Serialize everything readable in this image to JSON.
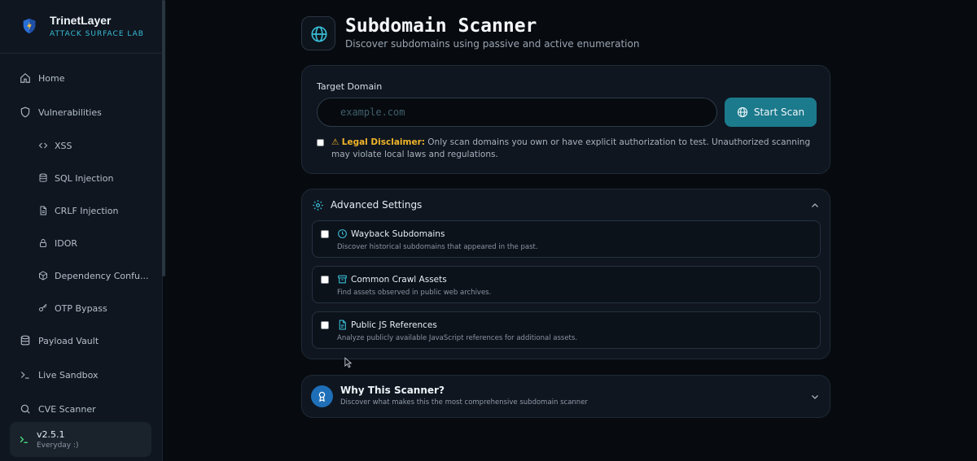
{
  "brand": {
    "name": "TrinetLayer",
    "tagline": "ATTACK SURFACE LAB"
  },
  "sidebar": {
    "items": [
      {
        "label": "Home",
        "icon": "home-icon"
      },
      {
        "label": "Vulnerabilities",
        "icon": "shield-icon"
      },
      {
        "label": "XSS",
        "icon": "code-icon"
      },
      {
        "label": "SQL Injection",
        "icon": "database-icon"
      },
      {
        "label": "CRLF Injection",
        "icon": "file-icon"
      },
      {
        "label": "IDOR",
        "icon": "lock-icon"
      },
      {
        "label": "Dependency Confu...",
        "icon": "package-icon"
      },
      {
        "label": "OTP Bypass",
        "icon": "key-icon"
      },
      {
        "label": "Payload Vault",
        "icon": "database-icon"
      },
      {
        "label": "Live Sandbox",
        "icon": "terminal-icon"
      },
      {
        "label": "CVE Scanner",
        "icon": "search-icon"
      }
    ],
    "version": {
      "label": "v2.5.1",
      "tagline": "Everyday :)"
    }
  },
  "header": {
    "title": "Subdomain Scanner",
    "subtitle": "Discover subdomains using passive and active enumeration"
  },
  "target": {
    "label": "Target Domain",
    "placeholder": "example.com",
    "value": "",
    "scan_label": "Start Scan",
    "disclaimer_title": "Legal Disclaimer:",
    "disclaimer_text": " Only scan domains you own or have explicit authorization to test. Unauthorized scanning may violate local laws and regulations.",
    "disclaimer_checked": false
  },
  "advanced": {
    "title": "Advanced Settings",
    "options": [
      {
        "title": "Wayback Subdomains",
        "desc": "Discover historical subdomains that appeared in the past.",
        "icon": "clock-icon",
        "checked": false
      },
      {
        "title": "Common Crawl Assets",
        "desc": "Find assets observed in public web archives.",
        "icon": "archive-icon",
        "checked": false
      },
      {
        "title": "Public JS References",
        "desc": "Analyze publicly available JavaScript references for additional assets.",
        "icon": "file-code-icon",
        "checked": false
      }
    ]
  },
  "why": {
    "title": "Why This Scanner?",
    "subtitle": "Discover what makes this the most comprehensive subdomain scanner"
  },
  "colors": {
    "accent": "#38bdd6",
    "button": "#1b7a8c",
    "warning": "#f0b429",
    "background": "#070b10",
    "card": "#0f1620"
  }
}
